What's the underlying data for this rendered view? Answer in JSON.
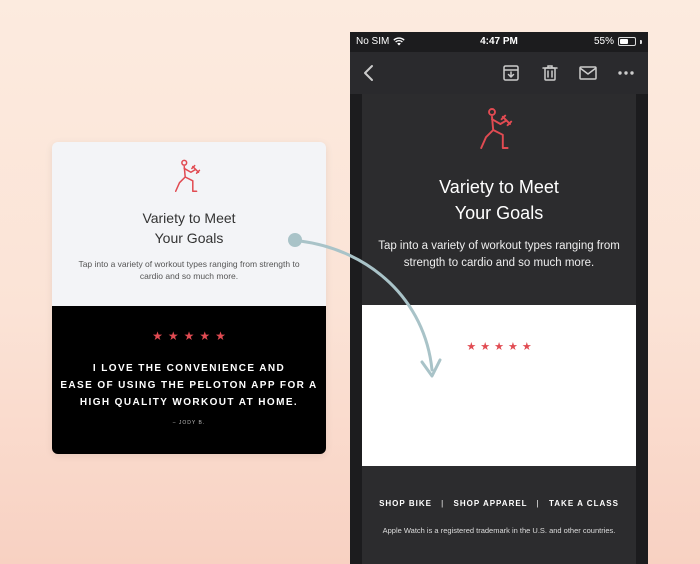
{
  "left_card": {
    "title": "Variety to Meet\nYour Goals",
    "description": "Tap into a variety of workout types ranging from strength to cardio and so much more.",
    "rating_stars": 5,
    "quote": "I LOVE THE CONVENIENCE AND\nEASE OF USING THE PELOTON APP FOR A\nHIGH QUALITY WORKOUT AT HOME.",
    "author": "– JODY B."
  },
  "status_bar": {
    "carrier": "No SIM",
    "time": "4:47 PM",
    "battery": "55%",
    "battery_level": 0.55
  },
  "toolbar": {
    "icons": [
      "back-icon",
      "archive-icon",
      "trash-icon",
      "mail-icon",
      "more-icon"
    ]
  },
  "email": {
    "title": "Variety to Meet\nYour Goals",
    "description": "Tap into a variety of workout types ranging from strength to cardio and so much more.",
    "rating_stars": 5,
    "footer_links": [
      "SHOP BIKE",
      "SHOP APPAREL",
      "TAKE A CLASS"
    ],
    "footer_separator": "|",
    "legal": "Apple Watch is a registered trademark in the U.S. and other countries."
  },
  "colors": {
    "accent_red": "#e14b52",
    "arrow": "#a9c3c8"
  }
}
